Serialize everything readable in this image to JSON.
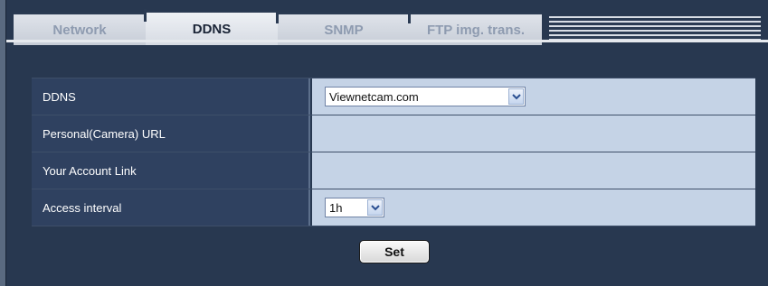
{
  "tabs": [
    {
      "label": "Network"
    },
    {
      "label": "DDNS"
    },
    {
      "label": "SNMP"
    },
    {
      "label": "FTP img. trans."
    }
  ],
  "active_tab": "DDNS",
  "form": {
    "rows": [
      {
        "label": "DDNS",
        "select_value": "Viewnetcam.com"
      },
      {
        "label": "Personal(Camera) URL"
      },
      {
        "label": "Your Account Link"
      },
      {
        "label": "Access interval",
        "select_value": "1h"
      }
    ]
  },
  "set_button_label": "Set",
  "colors": {
    "background": "#283850",
    "label_cell": "#2f4160",
    "value_cell": "#c5d3e6"
  },
  "icons": [
    "chevron-down-icon"
  ]
}
